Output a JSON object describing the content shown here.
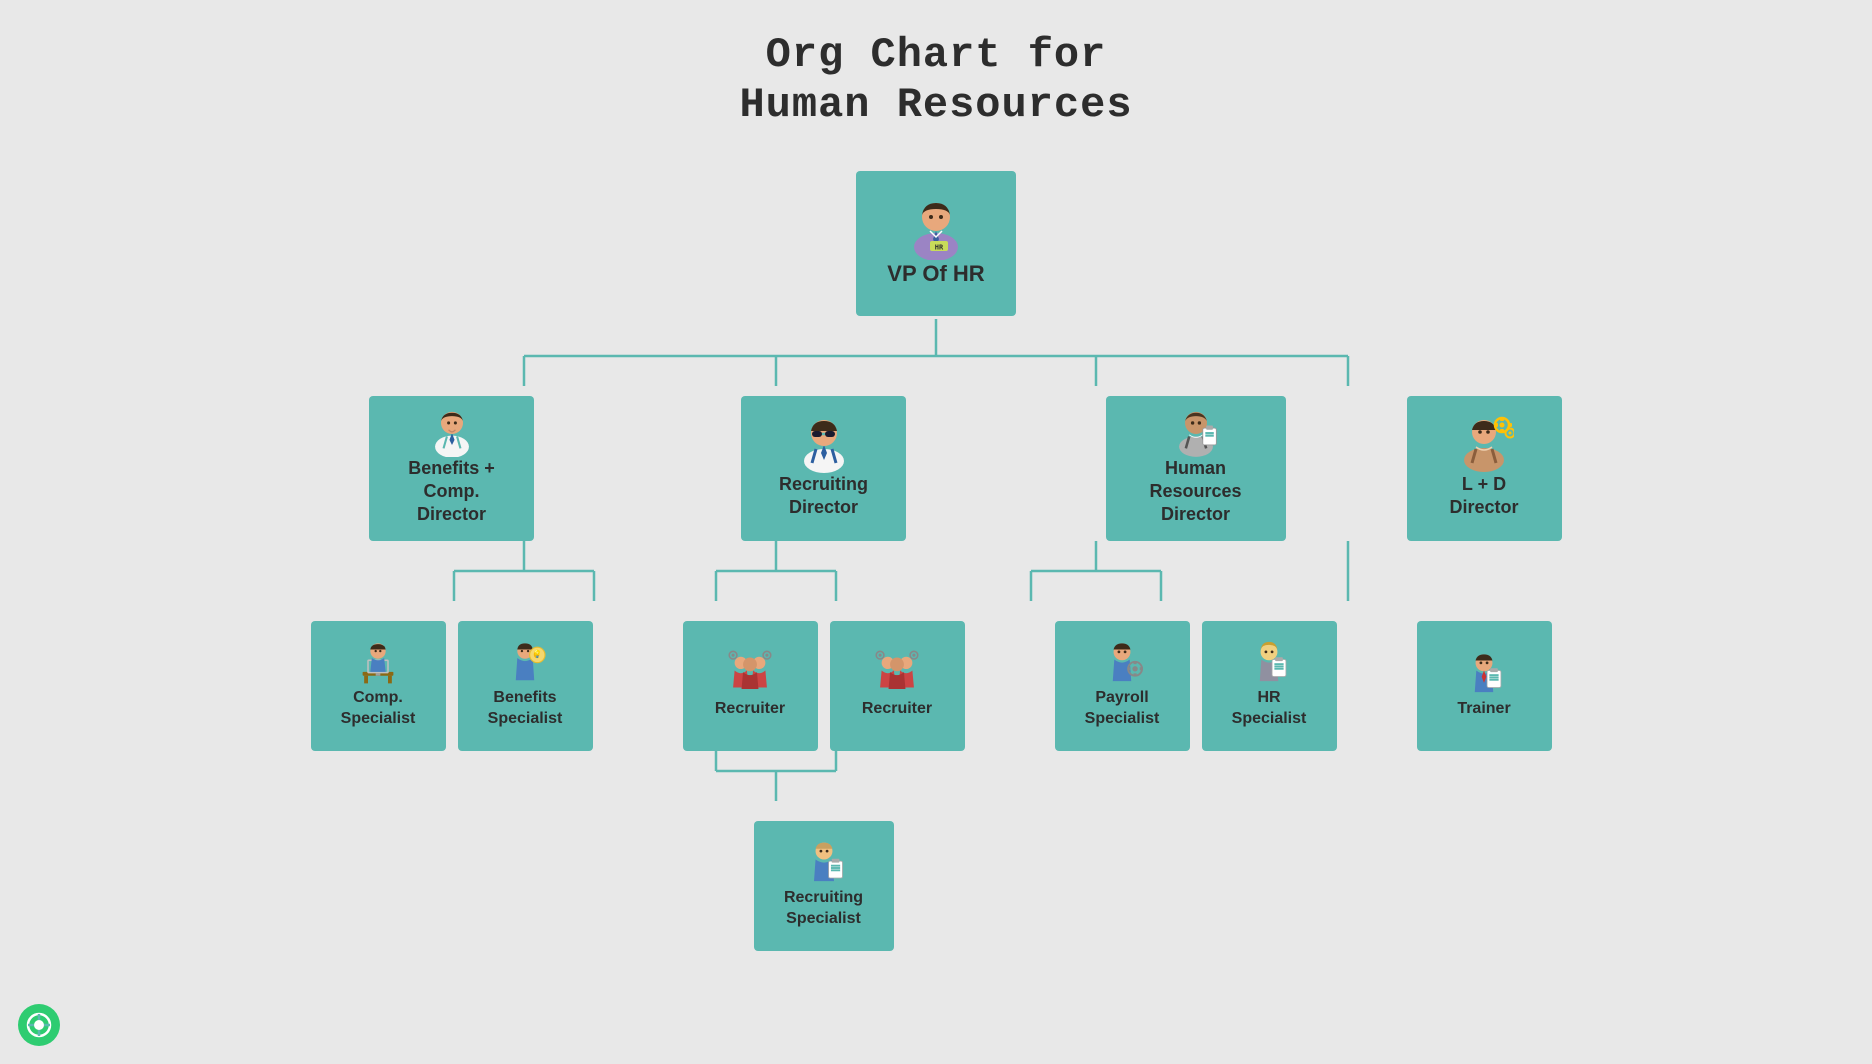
{
  "title": {
    "line1": "Org Chart for",
    "line2": "Human Resources"
  },
  "nodes": {
    "vp": {
      "label": "VP Of HR",
      "icon": "vp"
    },
    "directors": [
      {
        "id": "benefits-comp",
        "label": "Benefits + Comp.\nDirector",
        "icon": "benefits-comp"
      },
      {
        "id": "recruiting",
        "label": "Recruiting\nDirector",
        "icon": "recruiting"
      },
      {
        "id": "hr-director",
        "label": "Human Resources\nDirector",
        "icon": "hr-director"
      },
      {
        "id": "ld",
        "label": "L + D\nDirector",
        "icon": "ld"
      }
    ],
    "children": {
      "benefits-comp": [
        {
          "id": "comp-specialist",
          "label": "Comp.\nSpecialist",
          "icon": "comp-specialist"
        },
        {
          "id": "benefits-specialist",
          "label": "Benefits\nSpecialist",
          "icon": "benefits-specialist"
        }
      ],
      "recruiting": [
        {
          "id": "recruiter1",
          "label": "Recruiter",
          "icon": "recruiter"
        },
        {
          "id": "recruiter2",
          "label": "Recruiter",
          "icon": "recruiter"
        }
      ],
      "hr-director": [
        {
          "id": "payroll-specialist",
          "label": "Payroll\nSpecialist",
          "icon": "payroll-specialist"
        },
        {
          "id": "hr-specialist",
          "label": "HR\nSpecialist",
          "icon": "hr-specialist"
        }
      ],
      "ld": [
        {
          "id": "trainer",
          "label": "Trainer",
          "icon": "trainer"
        }
      ]
    },
    "grandchildren": {
      "recruiting": [
        {
          "id": "recruiting-specialist",
          "label": "Recruiting\nSpecialist",
          "icon": "recruiting-specialist"
        }
      ]
    }
  },
  "colors": {
    "node_bg": "#5bb8b0",
    "connector": "#5bb8b0",
    "bg": "#e8e8e8",
    "text": "#2d2d2d",
    "hr_badge_bg": "#c8dc5a"
  },
  "logo": {
    "icon": "©"
  }
}
